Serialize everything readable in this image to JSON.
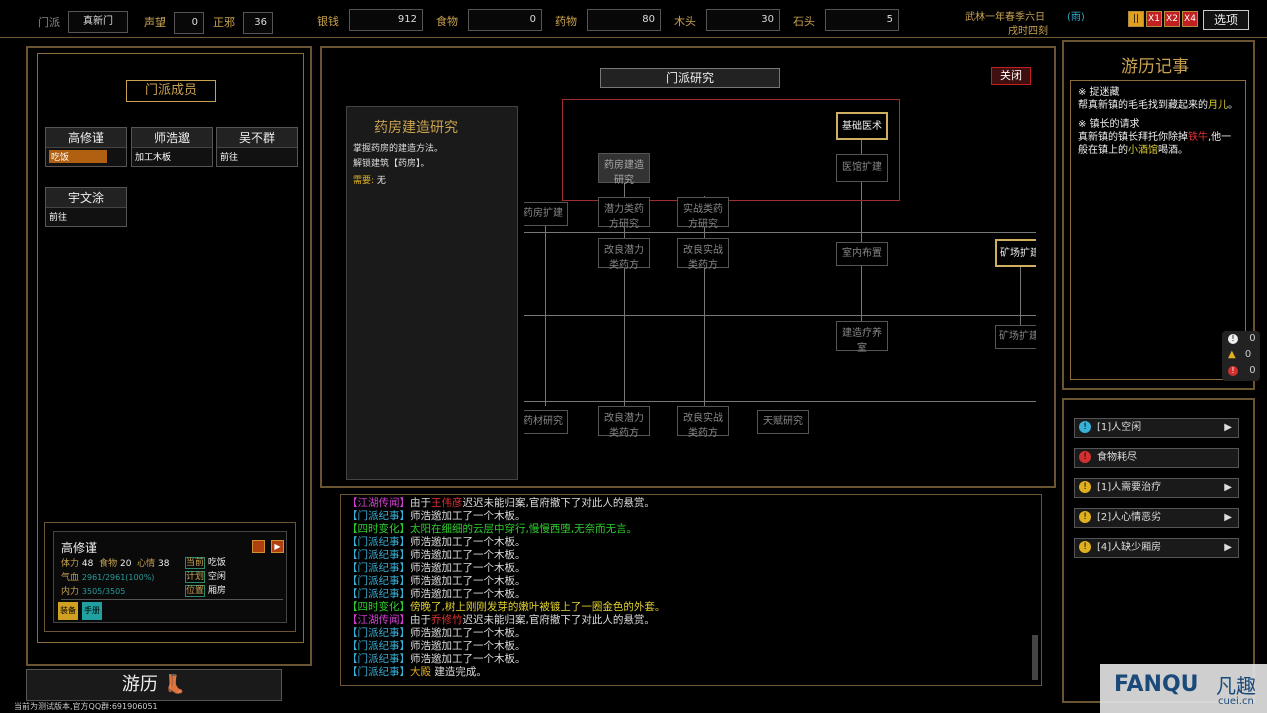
{
  "top": {
    "sect_label": "门派",
    "sect_name": "真新门",
    "fame_label": "声望",
    "fame": "0",
    "justice_label": "正邪",
    "justice": "36",
    "res": [
      {
        "label": "银钱",
        "val": "912"
      },
      {
        "label": "食物",
        "val": "0"
      },
      {
        "label": "药物",
        "val": "80"
      },
      {
        "label": "木头",
        "val": "30"
      },
      {
        "label": "石头",
        "val": "5"
      }
    ],
    "date": "武林一年春季六日",
    "weather": "雨",
    "time": "戌时四刻",
    "speed": [
      "X1",
      "X2",
      "X4"
    ],
    "options": "选项"
  },
  "members": {
    "title": "门派成员",
    "list": [
      {
        "name": "高修谨",
        "status": "吃饭"
      },
      {
        "name": "师浩邈",
        "status": "加工木板"
      },
      {
        "name": "吴不群",
        "status": "前往"
      },
      {
        "name": "宇文涂",
        "status": "前往"
      }
    ]
  },
  "detail": {
    "name": "高修谨",
    "stamina_l": "体力",
    "stamina": "48",
    "food_l": "食物",
    "food": "20",
    "mood_l": "心情",
    "mood": "38",
    "hp_l": "气血",
    "hp": "2961/2961(100%)",
    "inner_l": "内力",
    "inner": "3505/3505",
    "cur_l": "当前",
    "cur": "吃饭",
    "plan_l": "计划",
    "plan": "空闲",
    "pos_l": "位置",
    "pos": "厢房",
    "b1": "装备",
    "b2": "手册"
  },
  "travel": "游历",
  "footer": "当前为测试版本,官方QQ群:691906051",
  "research": {
    "title": "门派研究",
    "close": "关闭",
    "info_title": "药房建造研究",
    "info1": "掌握药房的建造方法。",
    "info2": "解锁建筑【药房】。",
    "need_l": "需要:",
    "need": "无",
    "nodes": [
      "基础医术",
      "医馆扩建",
      "药房建造研究",
      "药房扩建",
      "潜力类药方研究",
      "实战类药方研究",
      "改良潜力类药方",
      "改良实战类药方",
      "室内布置",
      "矿场扩建",
      "建造疗养室",
      "矿场扩建",
      "药材研究",
      "改良潜力类药方",
      "改良实战类药方",
      "天赋研究"
    ]
  },
  "journal": {
    "title": "游历记事",
    "q1t": "※ 捉迷藏",
    "q1a": "帮真新镇的毛毛找到藏起来的",
    "q1h": "月儿",
    "q1e": "。",
    "q2t": "※ 镇长的请求",
    "q2a": "真新镇的镇长拜托你除掉",
    "q2h": "铁牛",
    "q2b": ",他一般在镇上的",
    "q2h2": "小酒馆",
    "q2e": "喝酒。"
  },
  "counters": [
    "0",
    "0",
    "0"
  ],
  "alerts": [
    {
      "text": "[1]人空闲",
      "color": "#39b0d6",
      "arrow": true
    },
    {
      "text": "食物耗尽",
      "color": "#d43030",
      "arrow": false
    },
    {
      "text": "[1]人需要治疗",
      "color": "#e0b020",
      "arrow": true
    },
    {
      "text": "[2]人心情恶劣",
      "color": "#e0b020",
      "arrow": true
    },
    {
      "text": "[4]人缺少厢房",
      "color": "#e0b020",
      "arrow": true
    }
  ],
  "log": [
    {
      "tag": "【江湖传闻】",
      "tc": "#d040d0",
      "parts": [
        [
          "由于",
          "#ddd"
        ],
        [
          "王伟彦",
          "#e03030"
        ],
        [
          "迟迟未能归案,官府撤下了对此人的悬赏。",
          "#ddd"
        ]
      ]
    },
    {
      "tag": "【门派纪事】",
      "tc": "#39b0d6",
      "parts": [
        [
          "师浩邈加工了一个木板。",
          "#ddd"
        ]
      ]
    },
    {
      "tag": "【四时变化】",
      "tc": "#30d030",
      "parts": [
        [
          "太阳在细细的云层中穿行,慢慢西堕,无奈而无言。",
          "#30d030"
        ]
      ]
    },
    {
      "tag": "【门派纪事】",
      "tc": "#39b0d6",
      "parts": [
        [
          "师浩邈加工了一个木板。",
          "#ddd"
        ]
      ]
    },
    {
      "tag": "【门派纪事】",
      "tc": "#39b0d6",
      "parts": [
        [
          "师浩邈加工了一个木板。",
          "#ddd"
        ]
      ]
    },
    {
      "tag": "【门派纪事】",
      "tc": "#39b0d6",
      "parts": [
        [
          "师浩邈加工了一个木板。",
          "#ddd"
        ]
      ]
    },
    {
      "tag": "【门派纪事】",
      "tc": "#39b0d6",
      "parts": [
        [
          "师浩邈加工了一个木板。",
          "#ddd"
        ]
      ]
    },
    {
      "tag": "【门派纪事】",
      "tc": "#39b0d6",
      "parts": [
        [
          "师浩邈加工了一个木板。",
          "#ddd"
        ]
      ]
    },
    {
      "tag": "【四时变化】",
      "tc": "#30d030",
      "parts": [
        [
          "傍晚了,树上刚刚发芽的嫩叶被镀上了一圈金色的外套。",
          "#e0d030"
        ]
      ]
    },
    {
      "tag": "【江湖传闻】",
      "tc": "#d040d0",
      "parts": [
        [
          "由于",
          "#ddd"
        ],
        [
          "乔修竹",
          "#e03030"
        ],
        [
          "迟迟未能归案,官府撤下了对此人的悬赏。",
          "#ddd"
        ]
      ]
    },
    {
      "tag": "【门派纪事】",
      "tc": "#39b0d6",
      "parts": [
        [
          "师浩邈加工了一个木板。",
          "#ddd"
        ]
      ]
    },
    {
      "tag": "【门派纪事】",
      "tc": "#39b0d6",
      "parts": [
        [
          "师浩邈加工了一个木板。",
          "#ddd"
        ]
      ]
    },
    {
      "tag": "【门派纪事】",
      "tc": "#39b0d6",
      "parts": [
        [
          "师浩邈加工了一个木板。",
          "#ddd"
        ]
      ]
    },
    {
      "tag": "【门派纪事】",
      "tc": "#39b0d6",
      "parts": [
        [
          "大殿",
          "#e0b020"
        ],
        [
          " 建造完成。",
          "#ddd"
        ]
      ]
    }
  ],
  "watermark": {
    "text": "FANQU",
    "cn": "凡趣",
    "url": "cuei.cn"
  }
}
